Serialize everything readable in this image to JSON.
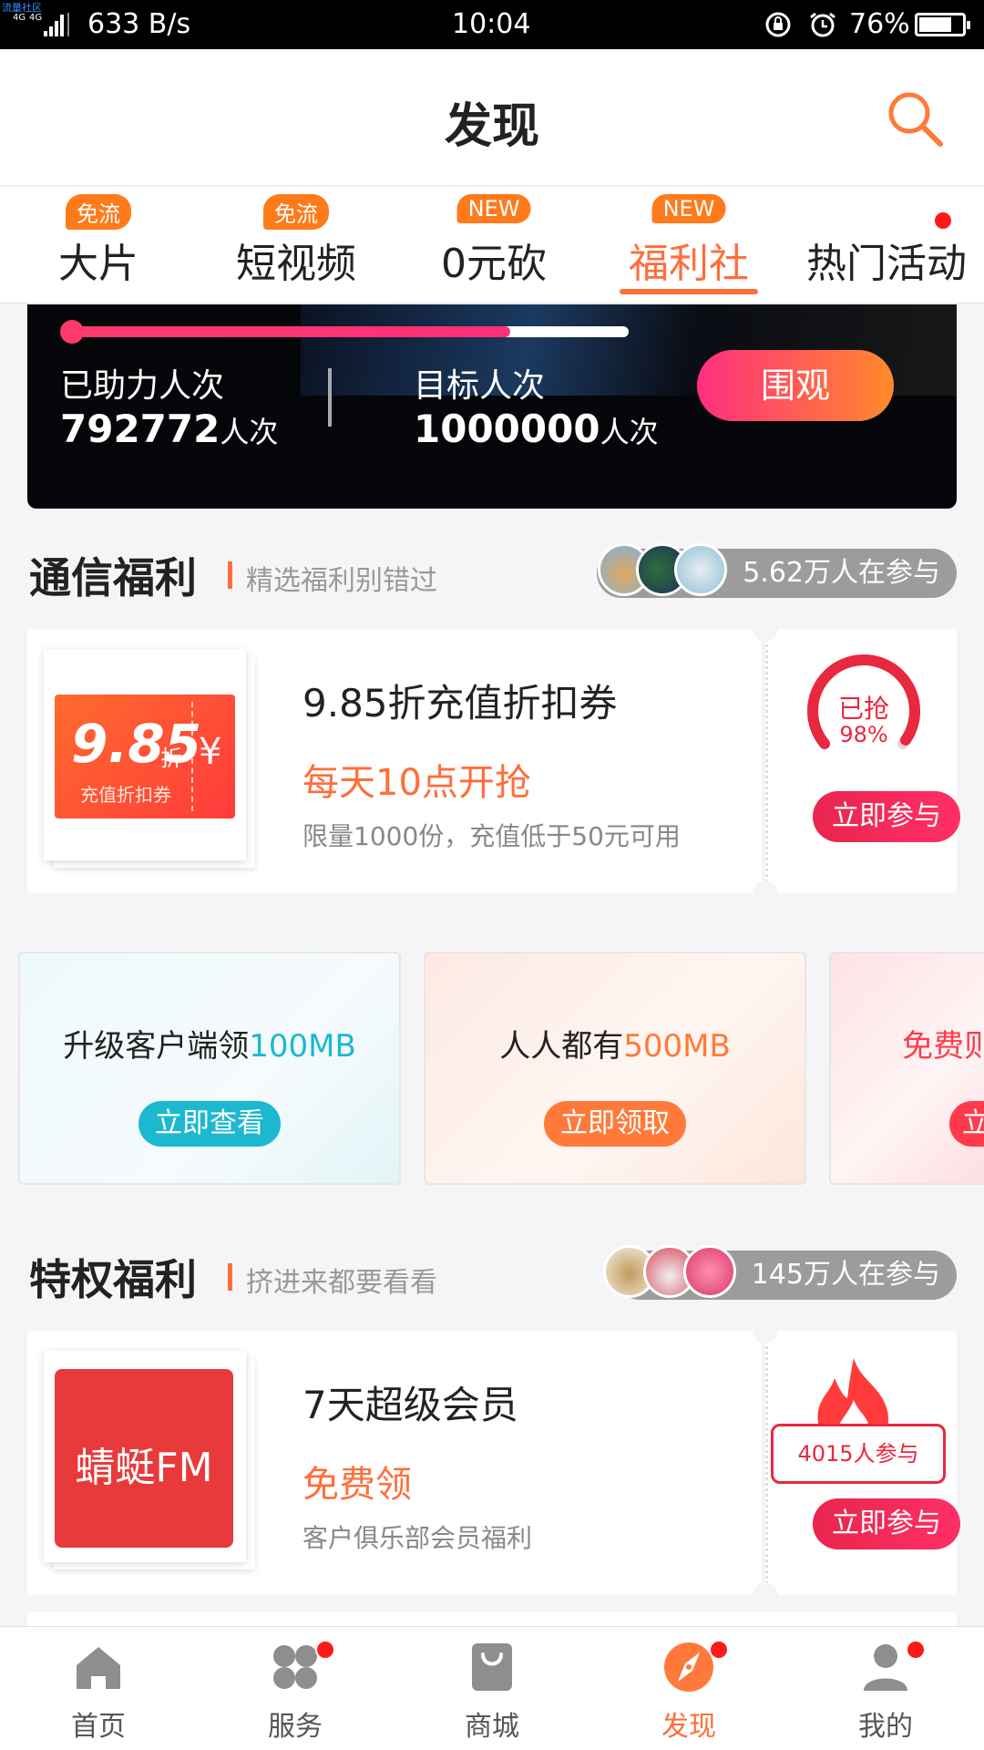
{
  "status_bar": {
    "carrier_tag": "流量社区",
    "network": "4G 4G",
    "speed": "633 B/s",
    "time": "10:04",
    "battery": "76%",
    "battery_level": 0.76
  },
  "header": {
    "title": "发现"
  },
  "tabs": [
    {
      "label": "大片",
      "badge": "免流",
      "active": false
    },
    {
      "label": "短视频",
      "badge": "免流",
      "active": false
    },
    {
      "label": "0元砍",
      "badge": "NEW",
      "active": false
    },
    {
      "label": "福利社",
      "badge": "NEW",
      "active": true
    },
    {
      "label": "热门活动",
      "badge": "",
      "active": false,
      "dot": true
    }
  ],
  "banner": {
    "progress": 0.79,
    "helped_label": "已助力人次",
    "helped_value": "792772",
    "helped_unit": "人次",
    "target_label": "目标人次",
    "target_value": "1000000",
    "target_unit": "人次",
    "cta": "围观"
  },
  "section_telecom": {
    "title": "通信福利",
    "subtitle": "精选福利别错过",
    "participants": "5.62万人在参与"
  },
  "coupon_card": {
    "image": {
      "big": "9.85",
      "unit": "折",
      "yen": "¥",
      "caption": "充值折扣券"
    },
    "title": "9.85折充值折扣券",
    "highlight": "每天10点开抢",
    "desc": "限量1000份，充值低于50元可用",
    "ring_label": "已抢",
    "ring_percent": "98%",
    "ring_value": 0.98,
    "join": "立即参与"
  },
  "promos": [
    {
      "text_a": "升级客户端领",
      "text_b": "100MB",
      "accent": "#1cb8cf",
      "button": "立即查看",
      "bg": "#eaf7f9"
    },
    {
      "text_a": "人人都有",
      "text_b": "500MB",
      "accent": "#ff7a3a",
      "button": "立即领取",
      "bg": "#fdf1ea"
    },
    {
      "text_a": "免费",
      "text_b": "则",
      "accent": "#ff3b4b",
      "button": "立",
      "bg": "#fdeef0"
    }
  ],
  "section_privilege": {
    "title": "特权福利",
    "subtitle": "挤进来都要看看",
    "participants": "145万人在参与"
  },
  "member_card": {
    "image_text": "蜻蜓FM",
    "title": "7天超级会员",
    "highlight": "免费领",
    "desc": "客户俱乐部会员福利",
    "count": "4015人参与",
    "join": "立即参与"
  },
  "bottom_nav": [
    {
      "label": "首页",
      "icon": "home-icon",
      "active": false,
      "dot": false
    },
    {
      "label": "服务",
      "icon": "services-icon",
      "active": false,
      "dot": true
    },
    {
      "label": "商城",
      "icon": "shop-bag-icon",
      "active": false,
      "dot": false
    },
    {
      "label": "发现",
      "icon": "compass-icon",
      "active": true,
      "dot": true
    },
    {
      "label": "我的",
      "icon": "user-icon",
      "active": false,
      "dot": true
    }
  ],
  "colors": {
    "accent": "#ff6e3a",
    "pink": "#ff2f66",
    "badge": "#ff7a1a"
  }
}
